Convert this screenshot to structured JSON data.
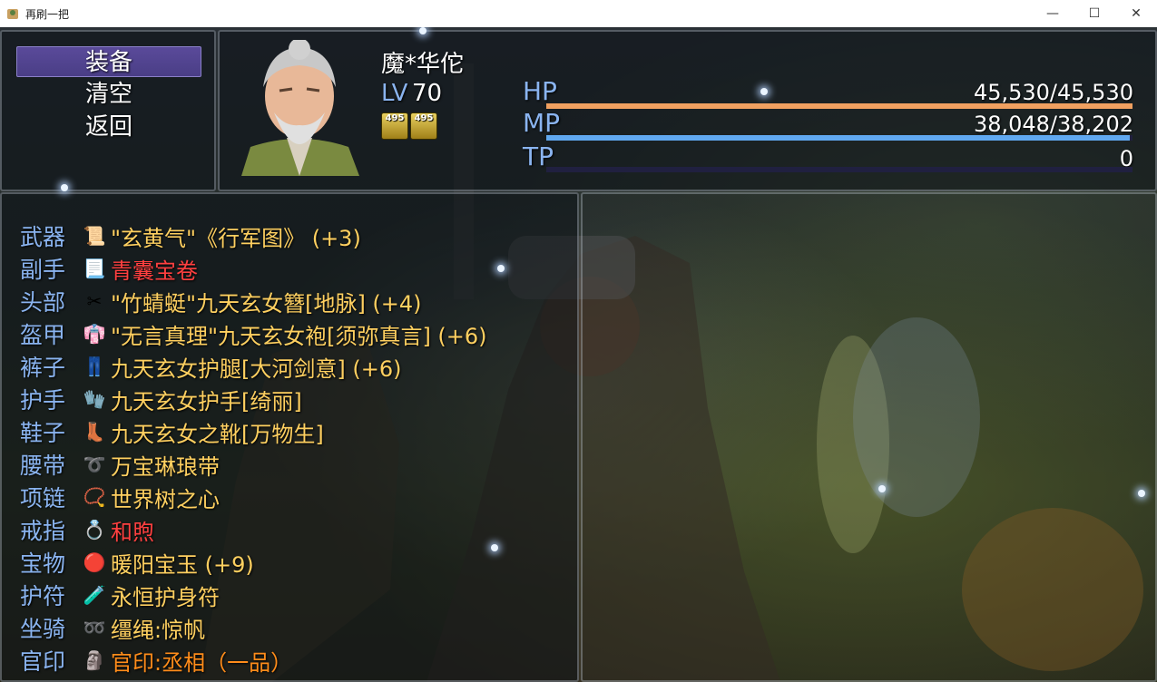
{
  "window": {
    "title": "再刷一把",
    "minimize_glyph": "—",
    "maximize_glyph": "☐",
    "close_glyph": "✕"
  },
  "commands": [
    {
      "label": "装备",
      "selected": true
    },
    {
      "label": "清空",
      "selected": false
    },
    {
      "label": "返回",
      "selected": false
    }
  ],
  "actor": {
    "name": "魔*华佗",
    "level_label": "LV",
    "level": "70",
    "states": [
      {
        "icon": "laurel-badge-icon",
        "text": "495"
      },
      {
        "icon": "shield-badge-icon",
        "text": "495"
      }
    ],
    "hp": {
      "label": "HP",
      "value": "45,530/45,530",
      "ratio": 1.0,
      "color": "#f0a060"
    },
    "mp": {
      "label": "MP",
      "value": "38,048/38,202",
      "ratio": 0.996,
      "color": "#60a8f0"
    },
    "tp": {
      "label": "TP",
      "value": "0",
      "ratio": 0,
      "color": "#60e060"
    }
  },
  "equipment": [
    {
      "slot": "武器",
      "icon": "scroll-icon",
      "name": "\"玄黄气\"《行军图》 (+3)",
      "color": "#ffd060"
    },
    {
      "slot": "副手",
      "icon": "scroll-roll-icon",
      "name": "青囊宝卷",
      "color": "#ff4040"
    },
    {
      "slot": "头部",
      "icon": "hairpin-icon",
      "name": "\"竹蜻蜓\"九天玄女簪[地脉] (+4)",
      "color": "#ffd060"
    },
    {
      "slot": "盔甲",
      "icon": "robe-icon",
      "name": "\"无言真理\"九天玄女袍[须弥真言] (+6)",
      "color": "#ffd060"
    },
    {
      "slot": "裤子",
      "icon": "pants-icon",
      "name": "九天玄女护腿[大河剑意] (+6)",
      "color": "#ffd060"
    },
    {
      "slot": "护手",
      "icon": "gloves-icon",
      "name": "九天玄女护手[绮丽]",
      "color": "#ffd060"
    },
    {
      "slot": "鞋子",
      "icon": "boots-icon",
      "name": "九天玄女之靴[万物生]",
      "color": "#ffd060"
    },
    {
      "slot": "腰带",
      "icon": "belt-icon",
      "name": "万宝琳琅带",
      "color": "#ffd060"
    },
    {
      "slot": "项链",
      "icon": "necklace-icon",
      "name": "世界树之心",
      "color": "#ffd060"
    },
    {
      "slot": "戒指",
      "icon": "ring-icon",
      "name": "和煦",
      "color": "#ff4040"
    },
    {
      "slot": "宝物",
      "icon": "red-orb-icon",
      "name": "暖阳宝玉 (+9)",
      "color": "#ffd060"
    },
    {
      "slot": "护符",
      "icon": "vial-icon",
      "name": "永恒护身符",
      "color": "#ffd060"
    },
    {
      "slot": "坐骑",
      "icon": "rope-icon",
      "name": "缰绳:惊帆",
      "color": "#ffd060"
    },
    {
      "slot": "官印",
      "icon": "seal-icon",
      "name": "官印:丞相（一品）",
      "color": "#ff8c1a"
    }
  ]
}
